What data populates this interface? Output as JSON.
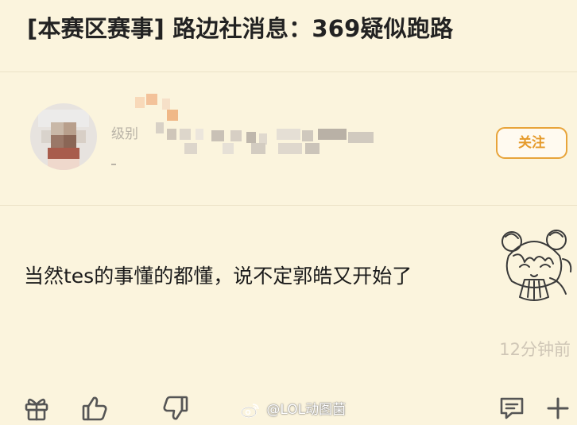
{
  "post": {
    "title": "[本赛区赛事] 路边社消息：369疑似跑路"
  },
  "author": {
    "level_label": "级别",
    "follow_label": "关注"
  },
  "comment": {
    "text": "当然tes的事懂的都懂，说不定郭皓又开始了",
    "time": "12分钟前"
  },
  "toolbar": {
    "gift_icon": "gift-icon",
    "like_icon": "thumbs-up-icon",
    "dislike_icon": "thumbs-down-icon",
    "reply_icon": "comment-icon",
    "more_icon": "plus-icon"
  },
  "watermark": {
    "text": "@LOL动图菌",
    "icon": "weibo-logo-icon"
  },
  "colors": {
    "background": "#fbf4dd",
    "accent": "#e8a43a",
    "timestamp": "#cfc6b6",
    "divider": "#ece3c8"
  }
}
